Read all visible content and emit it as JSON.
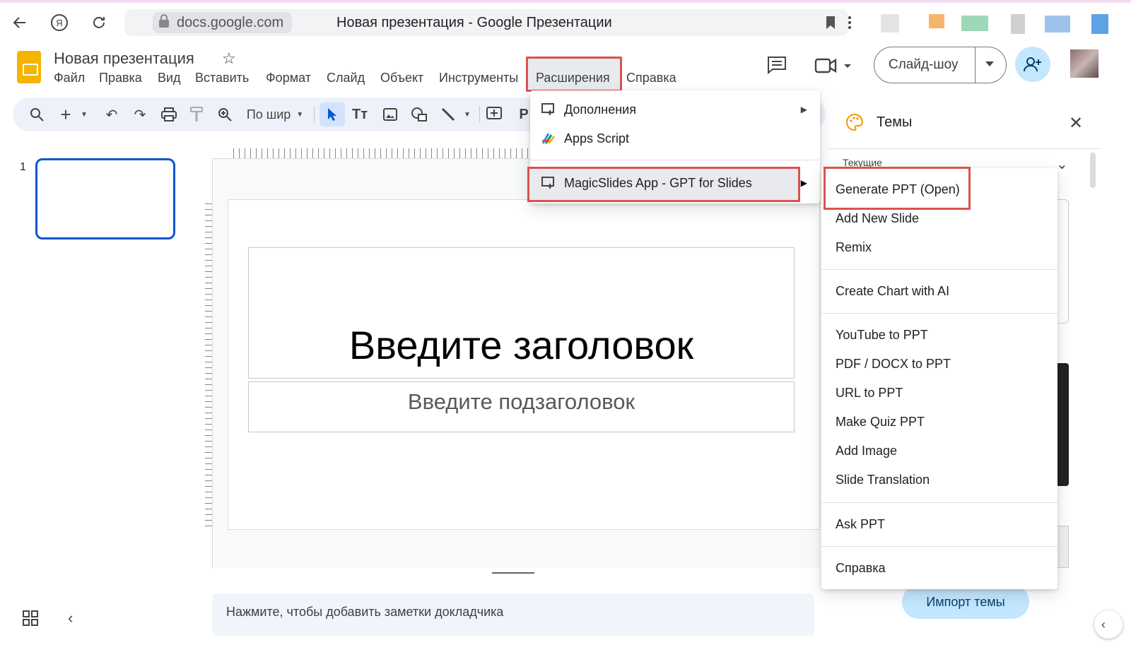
{
  "browser": {
    "url": "docs.google.com",
    "tab_title": "Новая презентация - Google Презентации"
  },
  "app": {
    "doc_title": "Новая презентация",
    "menu": [
      "Файл",
      "Правка",
      "Вид",
      "Вставить",
      "Формат",
      "Слайд",
      "Объект",
      "Инструменты",
      "Расширения",
      "Справка"
    ],
    "slideshow_label": "Слайд-шоу"
  },
  "toolbar": {
    "zoom_label": "По шир"
  },
  "filmstrip": {
    "slide_number": "1"
  },
  "slide": {
    "title_placeholder": "Введите заголовок",
    "subtitle_placeholder": "Введите подзаголовок"
  },
  "notes": {
    "placeholder": "Нажмите, чтобы добавить заметки докладчика"
  },
  "extensions_menu": {
    "items": [
      {
        "label": "Дополнения",
        "icon": "addon-icon",
        "has_submenu": true
      },
      {
        "label": "Apps Script",
        "icon": "apps-script-icon",
        "has_submenu": false
      },
      {
        "label": "MagicSlides App - GPT for Slides",
        "icon": "addon-icon",
        "has_submenu": true
      }
    ]
  },
  "magicslides_submenu": {
    "items": [
      "Generate PPT (Open)",
      "Add New Slide",
      "Remix",
      "Create Chart with AI",
      "YouTube to PPT",
      "PDF / DOCX to PPT",
      "URL to PPT",
      "Make Quiz PPT",
      "Add Image",
      "Slide Translation",
      "Ask PPT",
      "Справка"
    ]
  },
  "themes_panel": {
    "title": "Темы",
    "current_label": "Текущие",
    "import_label": "Импорт темы"
  },
  "colors": {
    "highlight": "#d9534f",
    "accent": "#0b57d0",
    "slides_logo": "#f4b400",
    "import_button": "#c2e7ff"
  }
}
